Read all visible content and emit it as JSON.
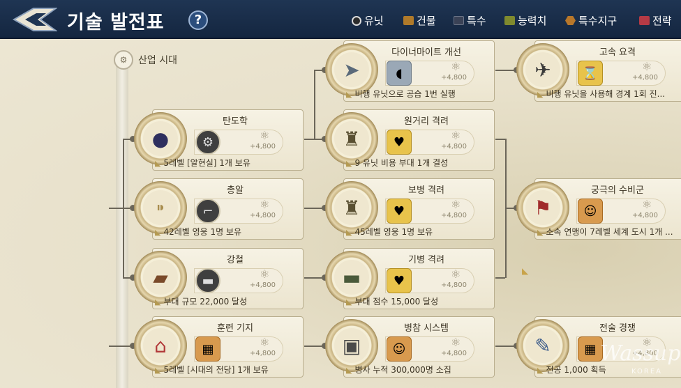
{
  "header": {
    "title": "기술 발전표",
    "help_glyph": "?",
    "legend": [
      {
        "label": "유닛",
        "color": "#2b2b2b"
      },
      {
        "label": "건물",
        "color": "#b07a2a"
      },
      {
        "label": "특수",
        "color": "#3a4256"
      },
      {
        "label": "능력치",
        "color": "#7f8a2e"
      },
      {
        "label": "특수지구",
        "color": "#b8772a"
      },
      {
        "label": "전략",
        "color": "#b53a45"
      }
    ]
  },
  "era": {
    "label": "산업 시대",
    "glyph": "⚙"
  },
  "cards": [
    {
      "name": "탄도학",
      "icon": "cannonball-pile-icon",
      "glyph": "●",
      "sub_icon": "field-cannon-icon",
      "sub_glyph": "⚙",
      "cost": "+4,800",
      "req": "5레벨 [알현실] 1개 보유",
      "sub_style": "dark"
    },
    {
      "name": "총알",
      "icon": "bullets-icon",
      "glyph": "⁍",
      "sub_icon": "rifle-icon",
      "sub_glyph": "⌐",
      "cost": "+4,800",
      "req": "42레벨 영웅 1명 보유",
      "sub_style": "dark"
    },
    {
      "name": "강철",
      "icon": "steel-ingot-icon",
      "glyph": "▰",
      "sub_icon": "tank-icon",
      "sub_glyph": "▬",
      "cost": "+4,800",
      "req": "부대 규모 22,000 달성",
      "sub_style": "dark"
    },
    {
      "name": "훈련 기지",
      "icon": "training-base-icon",
      "glyph": "⌂",
      "sub_icon": "bricks-icon",
      "sub_glyph": "▦",
      "cost": "+4,800",
      "req": "5레벨 [시대의 전당] 1개 보유",
      "sub_style": "orange"
    },
    {
      "name": "다이너마이트 개선",
      "icon": "missile-icon",
      "glyph": "➤",
      "sub_icon": "blimp-icon",
      "sub_glyph": "◖",
      "cost": "+4,800",
      "req": "비행 유닛으로 공습 1번 실행",
      "sub_style": "photo"
    },
    {
      "name": "원거리 격려",
      "icon": "riflemen-icon",
      "glyph": "♜",
      "sub_icon": "heart-timer-icon",
      "sub_glyph": "♥",
      "cost": "+4,800",
      "req": "9 유닛 비용 부대 1개 결성",
      "sub_style": "gold"
    },
    {
      "name": "보병 격려",
      "icon": "infantry-icon",
      "glyph": "♜",
      "sub_icon": "heart-timer-icon",
      "sub_glyph": "♥",
      "cost": "+4,800",
      "req": "45레벨 영웅 1명 보유",
      "sub_style": "gold"
    },
    {
      "name": "기병 격려",
      "icon": "tank-unit-icon",
      "glyph": "▬",
      "sub_icon": "heart-timer-icon",
      "sub_glyph": "♥",
      "cost": "+4,800",
      "req": "부대 점수 15,000 달성",
      "sub_style": "gold"
    },
    {
      "name": "병참 시스템",
      "icon": "supply-crate-icon",
      "glyph": "▣",
      "sub_icon": "soldier-portrait-icon",
      "sub_glyph": "☺",
      "cost": "+4,800",
      "req": "병사 누적 300,000명 소집",
      "sub_style": "orange"
    },
    {
      "name": "고속 요격",
      "icon": "fighter-plane-icon",
      "glyph": "✈",
      "sub_icon": "hourglass-icon",
      "sub_glyph": "⌛",
      "cost": "+4,800",
      "req": "비행 유닛을 사용해 경계 1회 진...",
      "sub_style": "gold"
    },
    {
      "name": "궁극의 수비군",
      "icon": "defense-army-icon",
      "glyph": "⚑",
      "sub_icon": "soldier-portrait-icon",
      "sub_glyph": "☺",
      "cost": "+4,800",
      "req": "소속 연맹이 7레벨 세계 도시 1개 ...",
      "sub_style": "orange"
    },
    {
      "name": "전술 경쟁",
      "icon": "tactics-map-icon",
      "glyph": "✎",
      "sub_icon": "bricks-icon",
      "sub_glyph": "▦",
      "cost": "+4,800",
      "req": "전공 1,000 획득",
      "sub_style": "orange"
    }
  ],
  "watermark": {
    "text": "Wassup",
    "sub": "KOREA"
  }
}
